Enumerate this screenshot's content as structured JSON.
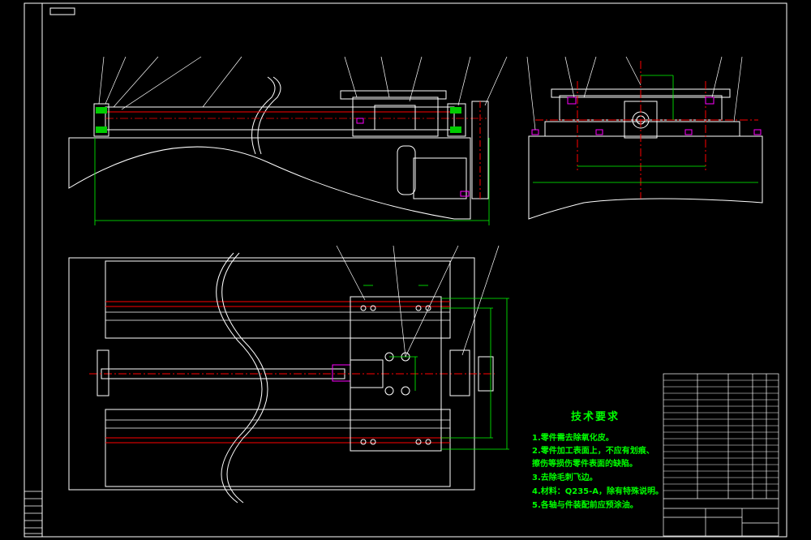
{
  "drawing": {
    "colors": {
      "background": "#000000",
      "frame": "#ffffff",
      "outline": "#ffffff",
      "centerline": "#ff0000",
      "dimension": "#00ff00",
      "hidden": "#ff00ff",
      "note_text": "#00ff00"
    }
  },
  "tech_requirements": {
    "title": "技术要求",
    "items": [
      "1.零件需去除氧化皮。",
      "2.零件加工表面上，不应有划痕、",
      "擦伤等损伤零件表面的缺陷。",
      "3.去除毛刺飞边。",
      "4.材料：Q235-A，除有特殊说明。",
      "5.各轴与件装配前应预涂油。"
    ]
  }
}
